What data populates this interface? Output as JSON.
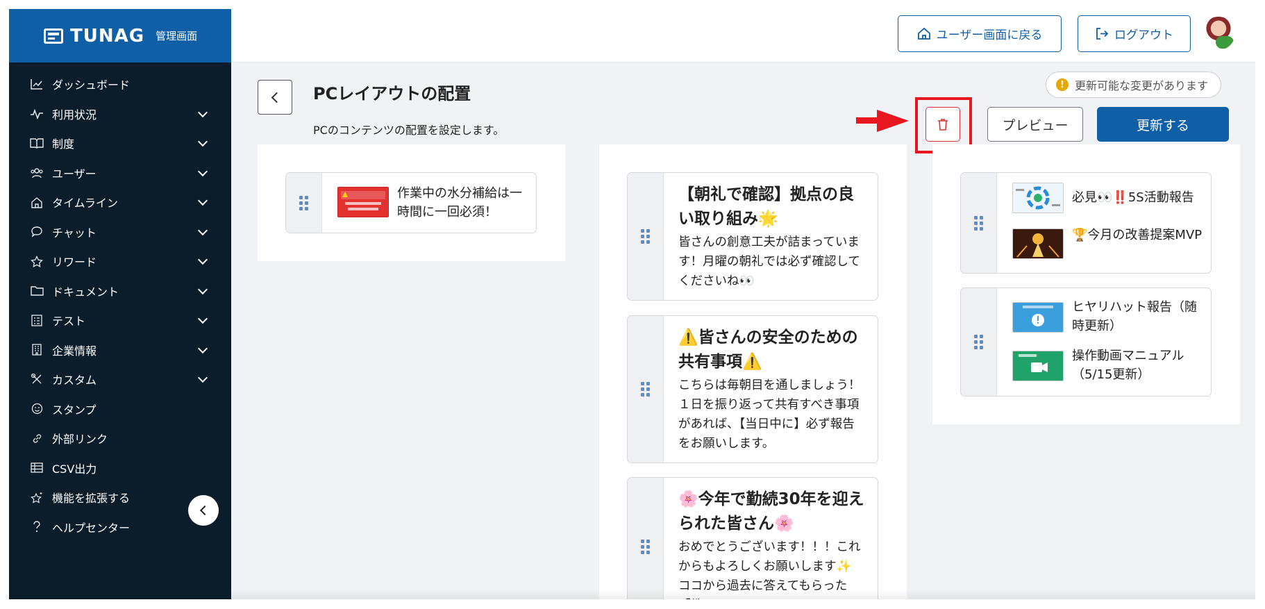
{
  "brand": {
    "name": "TUNAG",
    "sub": "管理画面",
    "accent": "#0f5fa6"
  },
  "header": {
    "user_screen_label": "ユーザー画面に戻る",
    "logout_label": "ログアウト"
  },
  "sidebar": {
    "items": [
      {
        "label": "ダッシュボード",
        "icon": "chart-icon",
        "glyph": "📈"
      },
      {
        "label": "利用状況",
        "icon": "pulse-icon",
        "glyph": "〜"
      },
      {
        "label": "制度",
        "icon": "book-icon",
        "glyph": "▯"
      },
      {
        "label": "ユーザー",
        "icon": "users-icon",
        "glyph": "⚇"
      },
      {
        "label": "タイムライン",
        "icon": "home-icon",
        "glyph": "⌂"
      },
      {
        "label": "チャット",
        "icon": "chat-icon",
        "glyph": "◯"
      },
      {
        "label": "リワード",
        "icon": "star-icon",
        "glyph": "☆"
      },
      {
        "label": "ドキュメント",
        "icon": "folder-icon",
        "glyph": "▭"
      },
      {
        "label": "テスト",
        "icon": "checklist-icon",
        "glyph": "☰"
      },
      {
        "label": "企業情報",
        "icon": "building-icon",
        "glyph": "▥"
      },
      {
        "label": "カスタム",
        "icon": "tools-icon",
        "glyph": "✕"
      },
      {
        "label": "スタンプ",
        "icon": "smile-icon",
        "glyph": "☺"
      },
      {
        "label": "外部リンク",
        "icon": "link-icon",
        "glyph": "🔗"
      },
      {
        "label": "CSV出力",
        "icon": "table-icon",
        "glyph": "▦"
      },
      {
        "label": "機能を拡張する",
        "icon": "sparkle-star-icon",
        "glyph": "☆"
      },
      {
        "label": "ヘルプセンター",
        "icon": "help-icon",
        "glyph": "?"
      }
    ]
  },
  "page": {
    "title": "PCレイアウトの配置",
    "subtitle": "PCのコンテンツの配置を設定します。",
    "status": "更新可能な変更があります",
    "preview_label": "プレビュー",
    "update_label": "更新する"
  },
  "columns": {
    "left": [
      {
        "text": "作業中の水分補給は一時間に一回必須！"
      }
    ],
    "middle": [
      {
        "title": "【朝礼で確認】拠点の良い取り組み🌟",
        "body": "皆さんの創意工夫が詰まっています！月曜の朝礼では必ず確認してくださいね👀"
      },
      {
        "title": "⚠️皆さんの安全のための共有事項⚠️",
        "body": "こちらは毎朝目を通しましょう！１日を振り返って共有すべき事項があれば、【当日中に】必ず報告をお願いします。"
      },
      {
        "title": "🌸今年で勤続30年を迎えられた皆さん🌸",
        "body": "おめでとうございます！！！これからもよろしくお願いします✨ ココから過去に答えてもらった「教"
      }
    ],
    "right": [
      {
        "items": [
          {
            "text": "必見👀‼️5S活動報告"
          },
          {
            "text": "🏆今月の改善提案MVP"
          }
        ]
      },
      {
        "items": [
          {
            "text": "ヒヤリハット報告（随時更新）"
          },
          {
            "text": "操作動画マニュアル（5/15更新）"
          }
        ]
      }
    ]
  }
}
